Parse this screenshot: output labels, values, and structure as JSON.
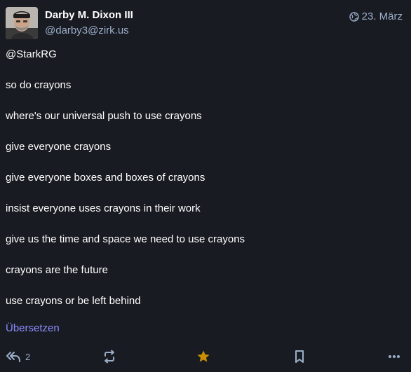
{
  "author": {
    "display_name": "Darby M. Dixon III",
    "handle": "@darby3@zirk.us",
    "avatar_icon": "avatar-photo"
  },
  "meta": {
    "date": "23. März",
    "visibility_icon": "globe-icon"
  },
  "content": {
    "lines": [
      "@StarkRG",
      "so do crayons",
      "where's our universal push to use crayons",
      "give everyone crayons",
      "give everyone boxes and boxes of crayons",
      "insist everyone uses crayons in their work",
      "give us the time and space we need to use crayons",
      "crayons are the future",
      "use crayons or be left behind"
    ]
  },
  "translate_label": "Übersetzen",
  "actions": {
    "reply_count": "2",
    "favourite_active": true
  },
  "colors": {
    "background": "#191b22",
    "text": "#ffffff",
    "muted": "#9baec8",
    "link": "#8c8dff",
    "star": "#ca8f04"
  }
}
